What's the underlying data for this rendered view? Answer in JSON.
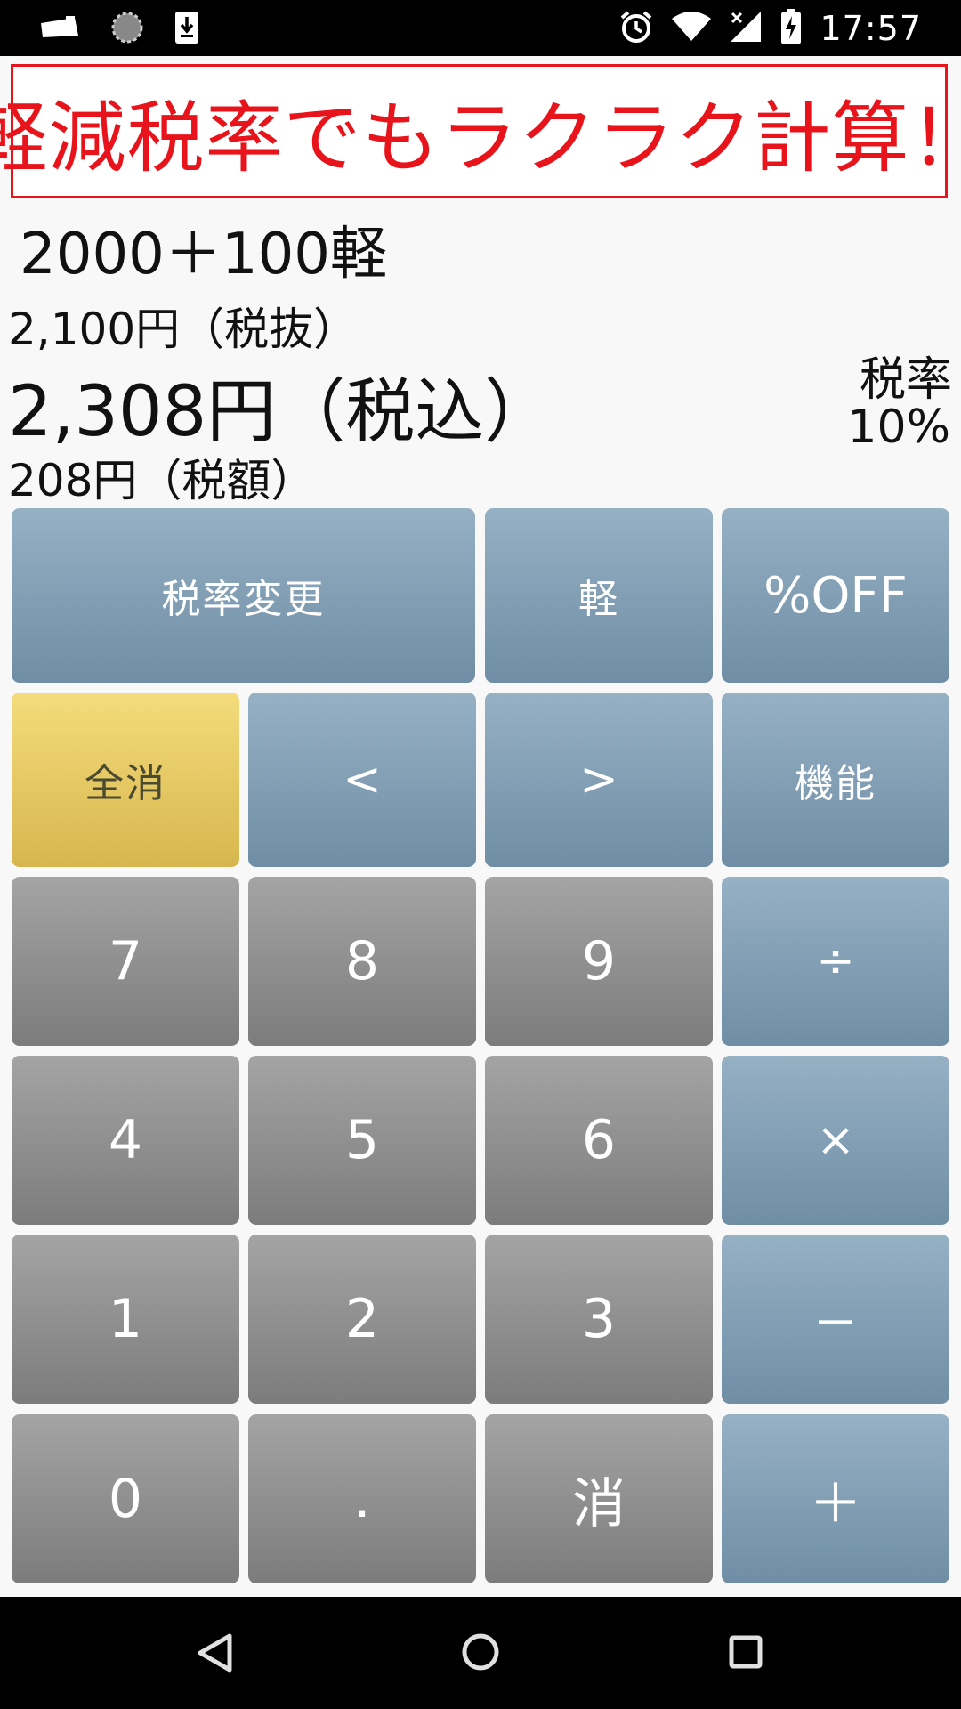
{
  "status_bar": {
    "time": "17:57",
    "left_icons": [
      "notification-tag-icon",
      "loading-circle-icon",
      "download-icon"
    ],
    "right_icons": [
      "alarm-icon",
      "wifi-icon",
      "signal-icon",
      "battery-charging-icon"
    ]
  },
  "banner": {
    "text": "軽減税率でもラクラク計算！",
    "color": "#e8141b"
  },
  "display": {
    "expression": "2000＋100軽",
    "pre_tax": "2,100円（税抜）",
    "with_tax": "2,308円（税込）",
    "tax_amount": "208円（税額）",
    "tax_rate_label": "税率",
    "tax_rate_value": "10%"
  },
  "keypad": {
    "row1": [
      "税率変更",
      "軽",
      "%OFF"
    ],
    "row2": [
      "全消",
      "<",
      ">",
      "機能"
    ],
    "row3": [
      "7",
      "8",
      "9",
      "÷"
    ],
    "row4": [
      "4",
      "5",
      "6",
      "×"
    ],
    "row5": [
      "1",
      "2",
      "3",
      "－"
    ],
    "row6": [
      "0",
      ".",
      "消",
      "＋"
    ]
  },
  "colors": {
    "function_key": "#7f9db3",
    "number_key": "#8e8e8e",
    "clear_all_key": "#e8c864"
  },
  "nav_bar": {
    "icons": [
      "back-icon",
      "home-icon",
      "recents-icon"
    ]
  }
}
